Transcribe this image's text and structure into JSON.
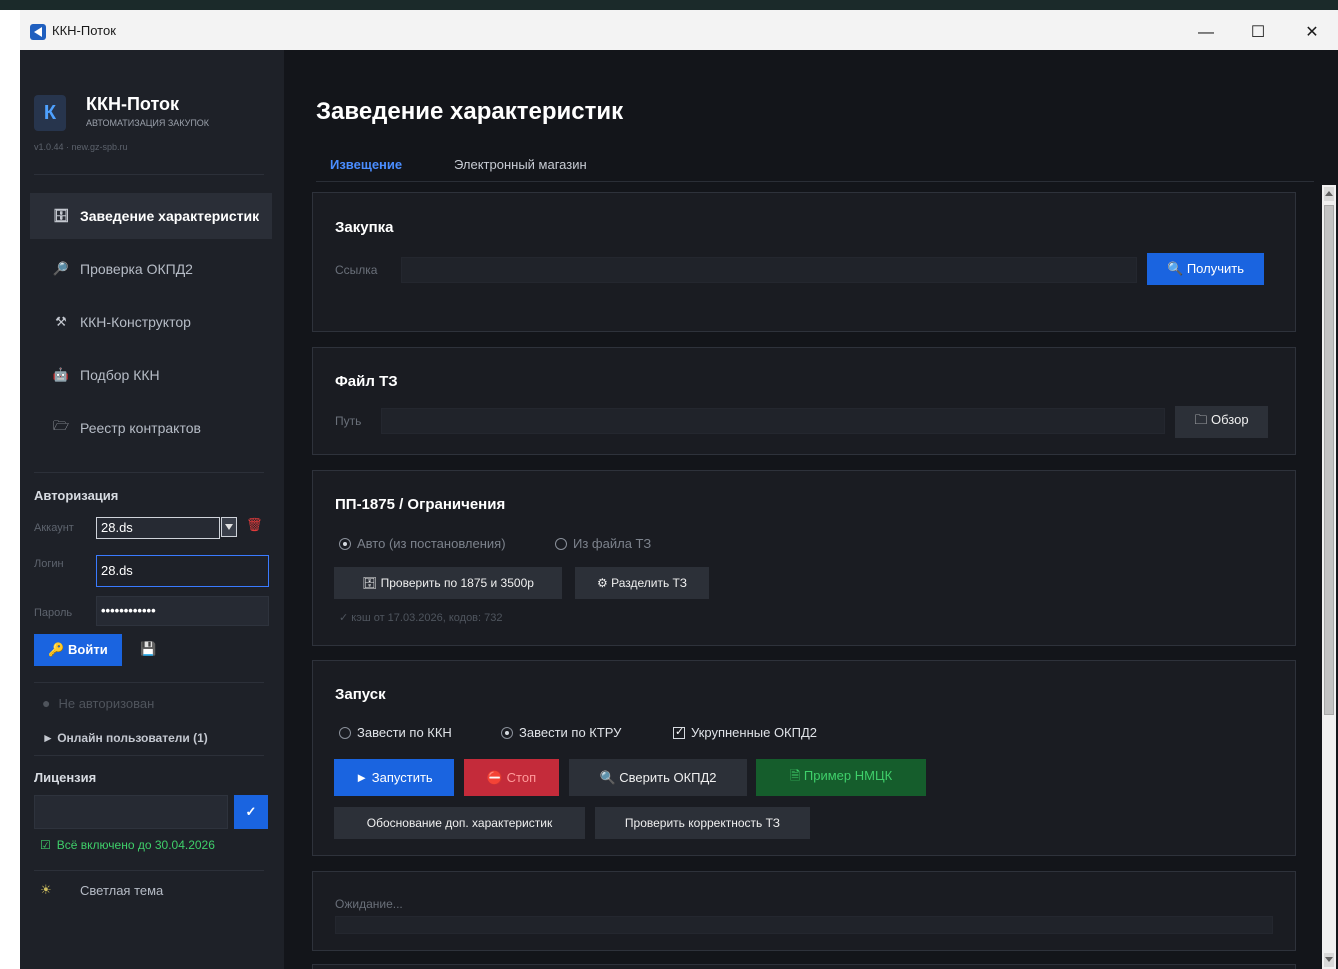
{
  "window": {
    "title": "ККН-Поток",
    "minimize": "—",
    "maximize": "☐",
    "close": "✕"
  },
  "sidebar": {
    "logo_letter": "К",
    "brand_title": "ККН-Поток",
    "brand_subtitle": "АВТОМАТИЗАЦИЯ ЗАКУПОК",
    "version": "v1.0.44 · new.gz-spb.ru",
    "nav": [
      {
        "icon": "🗄",
        "label": "Заведение характеристик"
      },
      {
        "icon": "🔎",
        "label": "Проверка ОКПД2"
      },
      {
        "icon": "⚒",
        "label": "ККН-Конструктор"
      },
      {
        "icon": "🤖",
        "label": "Подбор ККН"
      },
      {
        "icon": "🗁",
        "label": "Реестр контрактов"
      }
    ],
    "auth": {
      "heading": "Авторизация",
      "account_label": "Аккаунт",
      "account_value": "28.ds",
      "delete_icon": "🗑",
      "login_label": "Логин",
      "login_value": "28.ds",
      "password_label": "Пароль",
      "password_value": "••••••••••••",
      "login_button": "🔑 Войти",
      "save_icon": "💾"
    },
    "status_dot": "●",
    "status": "Не авторизован",
    "online_users": "► Онлайн пользователи (1)",
    "license": {
      "heading": "Лицензия",
      "input_value": "",
      "confirm_icon": "✓",
      "status_icon": "☑",
      "status": "Всё включено до 30.04.2026"
    },
    "theme_icon": "☀",
    "theme_toggle": "Светлая тема"
  },
  "main": {
    "title": "Заведение характеристик",
    "tabs": [
      "Извещение",
      "Электронный магазин"
    ],
    "purchase": {
      "title": "Закупка",
      "link_label": "Ссылка",
      "link_value": "",
      "get_button": "🔍 Получить"
    },
    "tz_file": {
      "title": "Файл ТЗ",
      "path_label": "Путь",
      "path_value": "",
      "browse_button": "🗀 Обзор"
    },
    "pp1875": {
      "title": "ПП-1875 / Ограничения",
      "radio_auto": "Авто (из постановления)",
      "radio_file": "Из файла ТЗ",
      "check_button": "🗄 Проверить по 1875 и 3500р",
      "split_button": "⚙ Разделить ТЗ",
      "cache_info": "✓ кэш от 17.03.2026, кодов: 732"
    },
    "launch": {
      "title": "Запуск",
      "radio_kkn": "Завести по ККН",
      "radio_ktru": "Завести по КТРУ",
      "check_enlarged": "Укрупненные ОКПД2",
      "start_button": "► Запустить",
      "stop_button": "⛔ Стоп",
      "verify_button": "🔍 Сверить ОКПД2",
      "nmck_button": "🗎 Пример НМЦК",
      "justify_button": "Обоснование доп. характеристик",
      "check_tz_button": "Проверить корректность ТЗ"
    },
    "progress": {
      "status": "Ожидание...",
      "fraction": 0
    }
  },
  "colors": {
    "accent": "#1a64e0",
    "danger": "#c42b3a",
    "success": "#3fcf6a",
    "sidebar_bg": "#1e2128",
    "content_bg": "#13151a"
  }
}
